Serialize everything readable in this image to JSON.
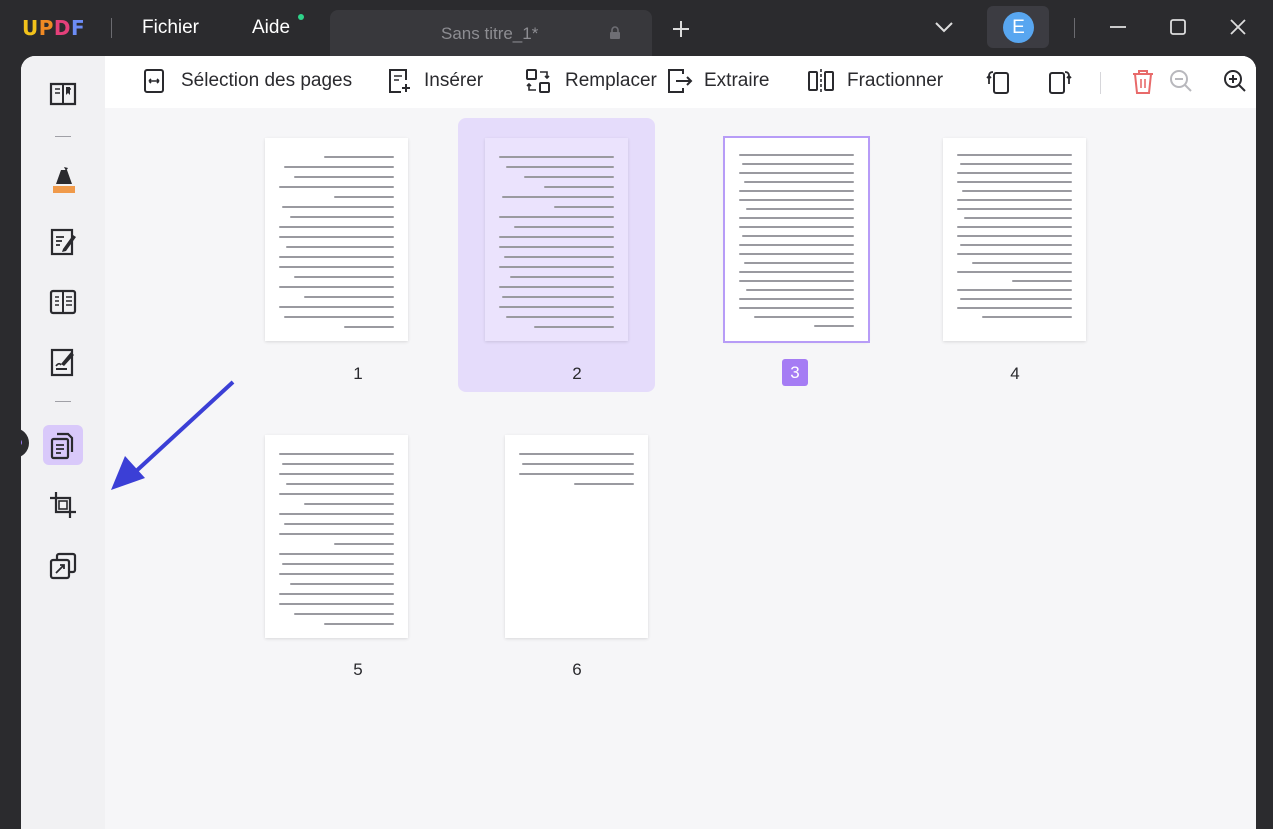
{
  "app": {
    "logo": {
      "u": "U",
      "p": "P",
      "d": "D",
      "f": "F"
    },
    "menu": {
      "file": "Fichier",
      "help": "Aide"
    },
    "tab": {
      "title": "Sans titre_1*"
    },
    "user": {
      "initial": "E"
    },
    "colors": {
      "accent": "#a57cf4",
      "titlebar": "#2b2b2e",
      "avatar": "#58a6f0"
    }
  },
  "toolbar": {
    "select_pages": "Sélection des pages",
    "insert": "Insérer",
    "replace": "Remplacer",
    "extract": "Extraire",
    "split": "Fractionner",
    "icons": [
      "rotate-left-icon",
      "rotate-right-icon",
      "delete-icon",
      "zoom-out-icon",
      "zoom-in-icon"
    ]
  },
  "sidebar": {
    "items": [
      "reader-icon",
      "comment-icon",
      "edit-icon",
      "form-icon",
      "sign-icon",
      "organize-pages-icon",
      "crop-icon",
      "convert-icon"
    ],
    "active": "organize-pages-icon"
  },
  "pages": [
    {
      "number": "1"
    },
    {
      "number": "2"
    },
    {
      "number": "3"
    },
    {
      "number": "4"
    },
    {
      "number": "5"
    },
    {
      "number": "6"
    }
  ],
  "selected_page": "3"
}
